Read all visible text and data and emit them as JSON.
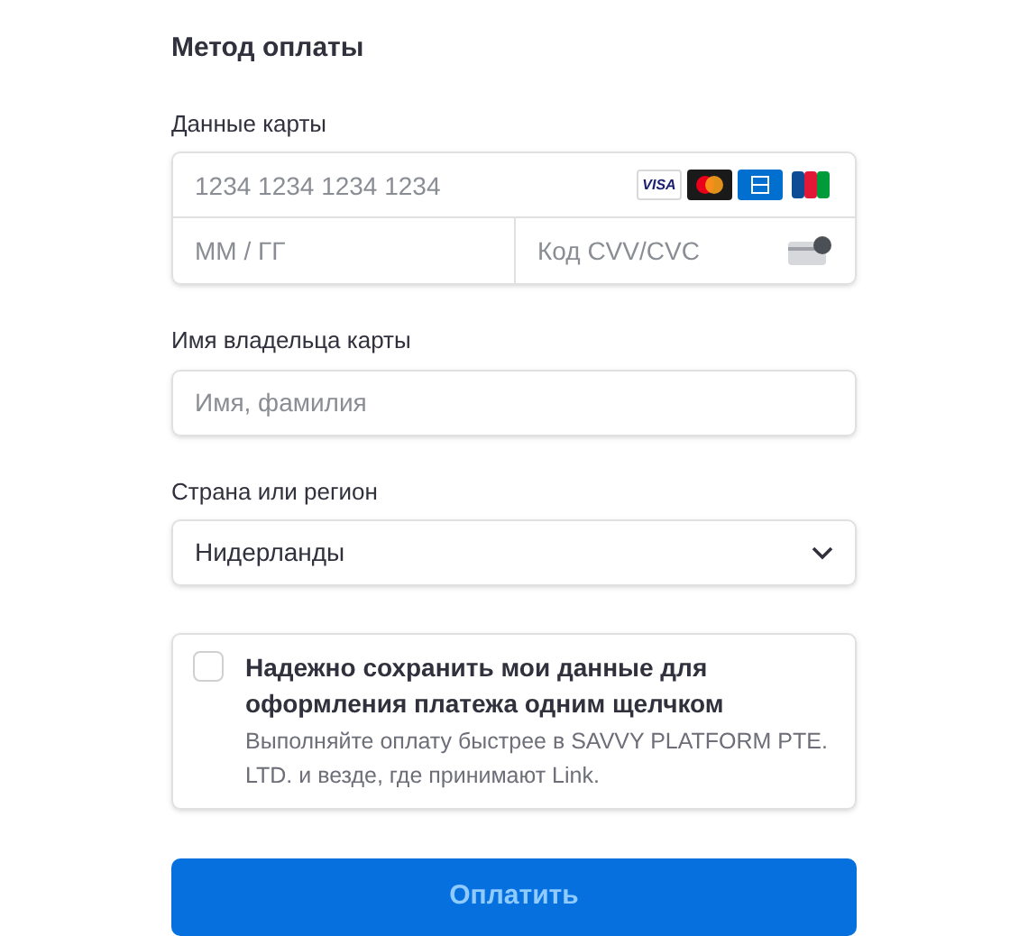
{
  "title": "Метод оплаты",
  "card": {
    "label": "Данные карты",
    "number_placeholder": "1234 1234 1234 1234",
    "expiry_placeholder": "ММ / ГГ",
    "cvc_placeholder": "Код CVV/CVC",
    "brands": [
      {
        "kind": "visa",
        "label": "VISA"
      },
      {
        "kind": "mastercard"
      },
      {
        "kind": "amex"
      },
      {
        "kind": "jcb"
      }
    ]
  },
  "name": {
    "label": "Имя владельца карты",
    "placeholder": "Имя, фамилия"
  },
  "country": {
    "label": "Страна или регион",
    "value": "Нидерланды"
  },
  "save": {
    "checked": false,
    "title": "Надежно сохранить мои данные для оформления платежа одним щелчком",
    "description": "Выполняйте оплату быстрее в SAVVY PLATFORM PTE. LTD. и везде, где принимают Link."
  },
  "pay_button": {
    "label": "Оплатить",
    "disabled": true
  }
}
